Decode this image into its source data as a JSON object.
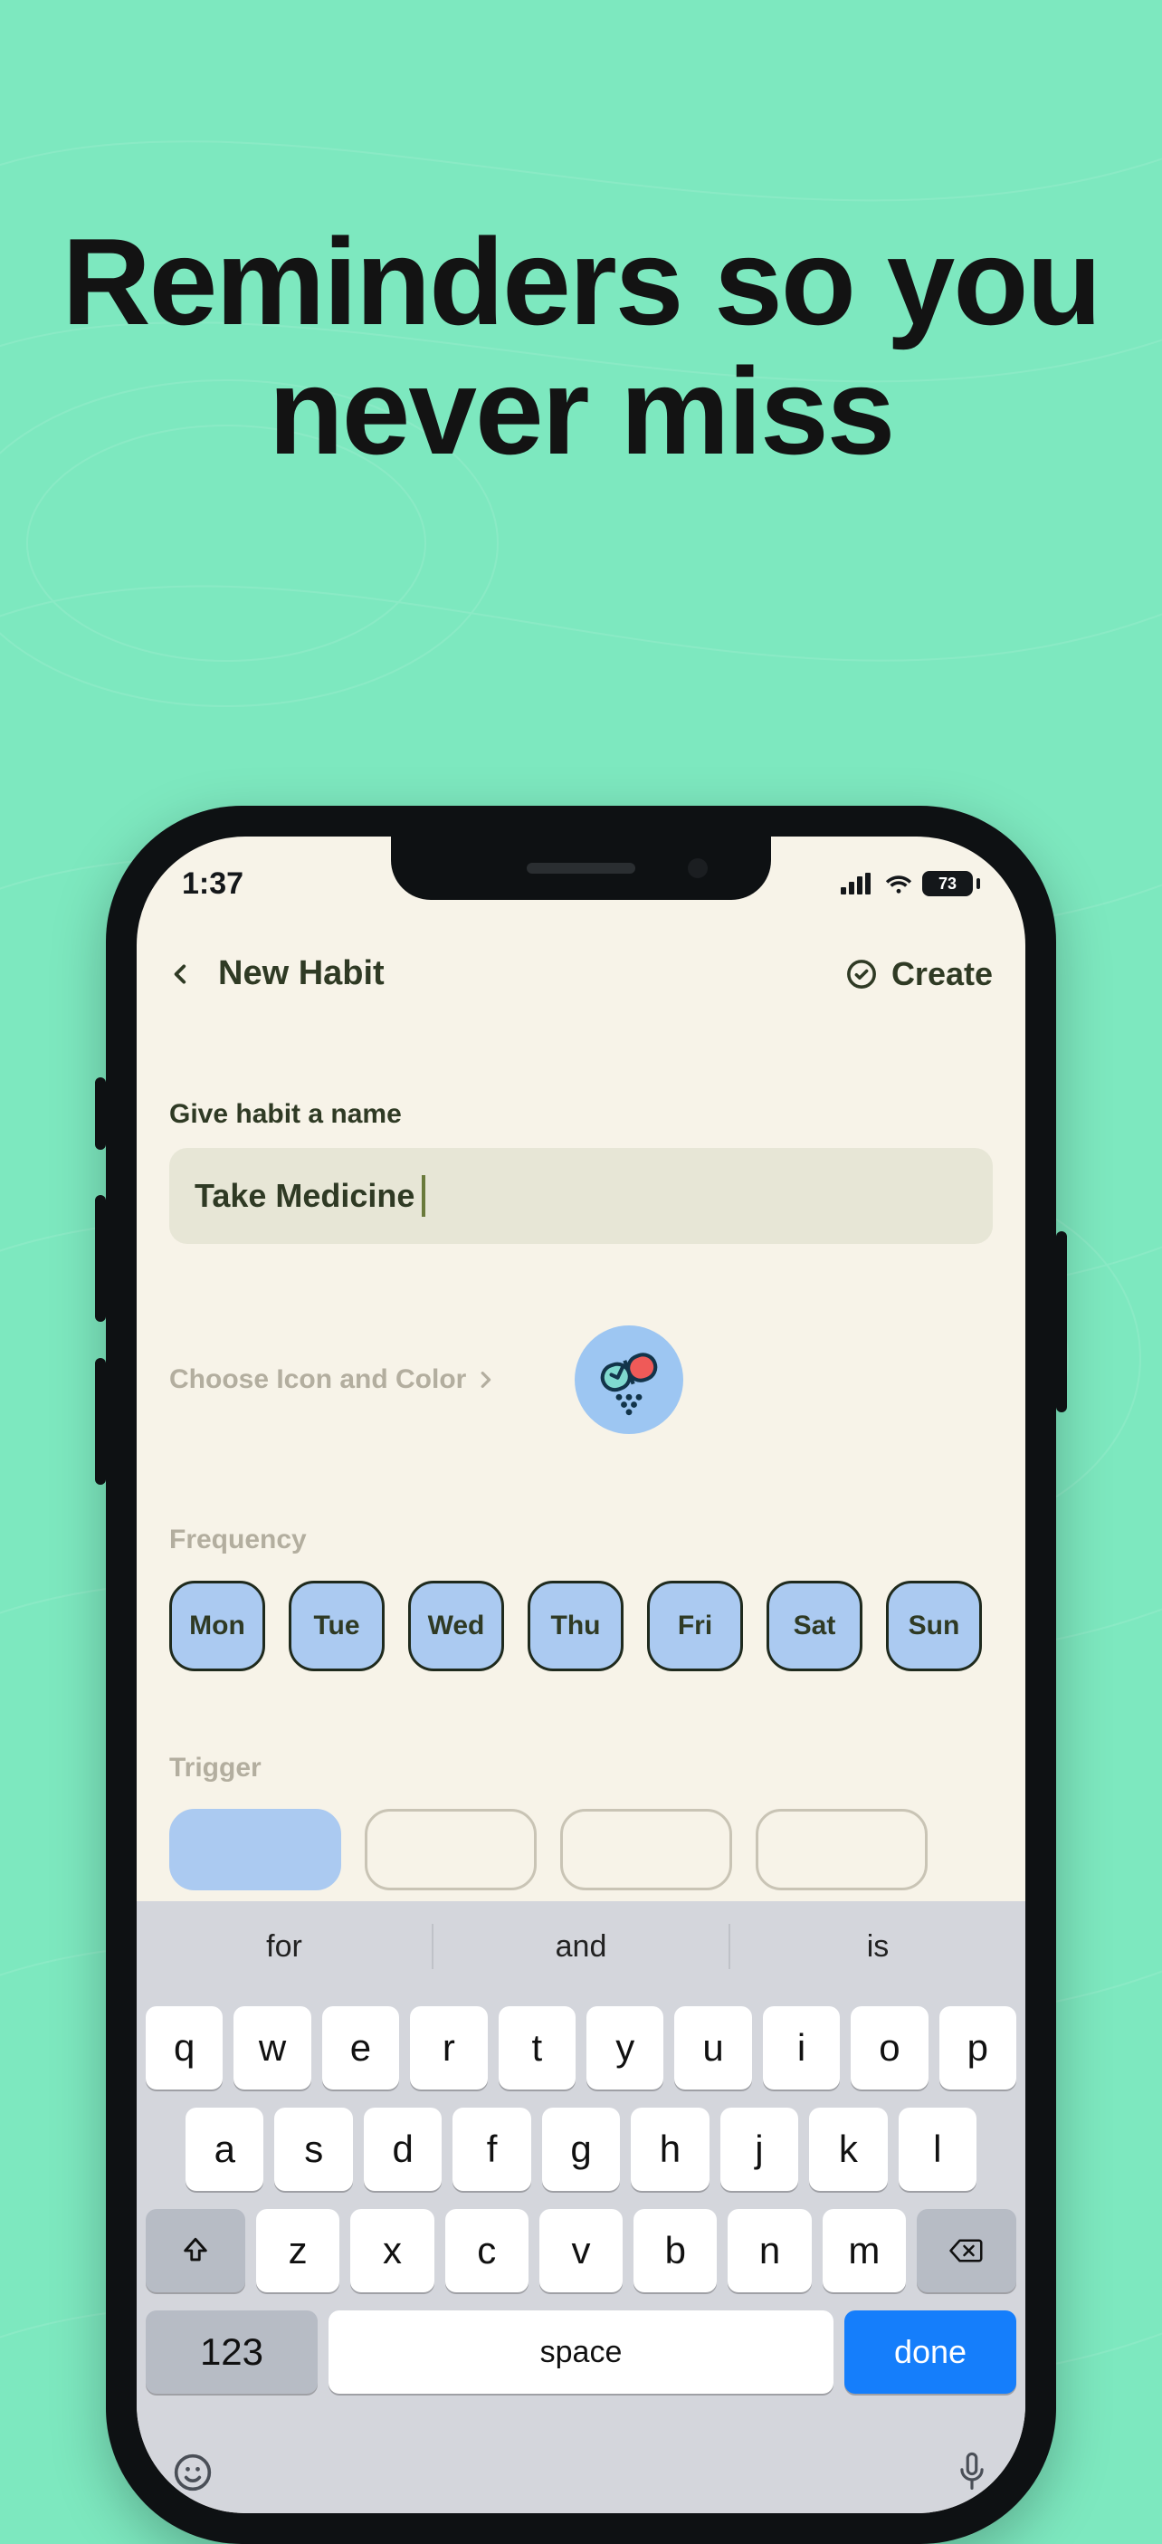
{
  "hero": {
    "title": "Reminders so you never miss"
  },
  "status": {
    "time": "1:37",
    "battery": "73"
  },
  "nav": {
    "title": "New Habit",
    "create": "Create"
  },
  "form": {
    "name_label": "Give habit a name",
    "name_value": "Take Medicine",
    "icon_label": "Choose Icon and Color",
    "icon_name": "pill-icon",
    "frequency_label": "Frequency",
    "days": [
      "Mon",
      "Tue",
      "Wed",
      "Thu",
      "Fri",
      "Sat",
      "Sun"
    ],
    "trigger_label": "Trigger"
  },
  "keyboard": {
    "suggestions": [
      "for",
      "and",
      "is"
    ],
    "row1": [
      "q",
      "w",
      "e",
      "r",
      "t",
      "y",
      "u",
      "i",
      "o",
      "p"
    ],
    "row2": [
      "a",
      "s",
      "d",
      "f",
      "g",
      "h",
      "j",
      "k",
      "l"
    ],
    "row3": [
      "z",
      "x",
      "c",
      "v",
      "b",
      "n",
      "m"
    ],
    "num": "123",
    "space": "space",
    "done": "done"
  }
}
